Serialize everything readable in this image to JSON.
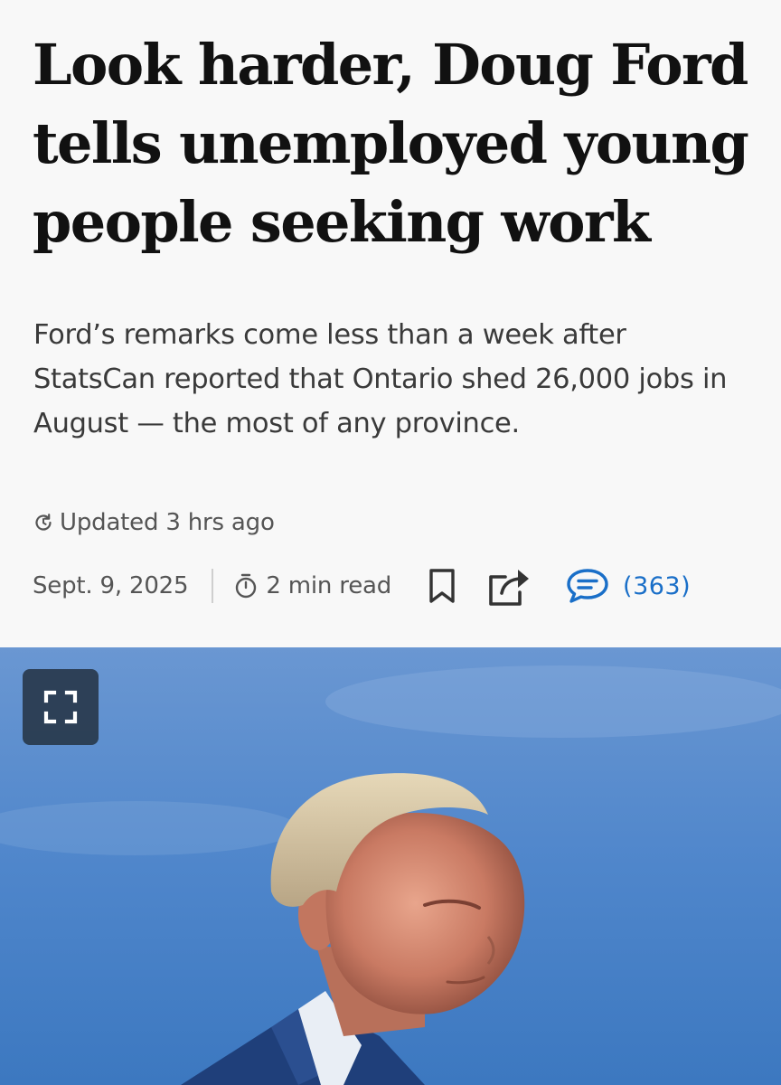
{
  "article": {
    "headline": "Look harder, Doug Ford tells unemployed young people seeking work",
    "dek": "Ford’s remarks come less than a week after StatsCan reported that Ontario shed 26,000 jobs in August — the most of any province.",
    "updated": "Updated 3 hrs ago",
    "date": "Sept. 9, 2025",
    "read_time": "2 min read",
    "comment_count": "(363)"
  },
  "icons": {
    "updated": "refresh-icon",
    "read_time": "stopwatch-icon",
    "bookmark": "bookmark-icon",
    "share": "share-icon",
    "comments": "comment-bubble-icon",
    "expand": "expand-icon"
  },
  "colors": {
    "background": "#f8f8f8",
    "headline": "#111111",
    "body_text": "#3a3a3a",
    "meta_text": "#555555",
    "accent_link": "#1a6fc8",
    "photo_sky": "#5388cc",
    "expand_button_bg": "#263446"
  }
}
